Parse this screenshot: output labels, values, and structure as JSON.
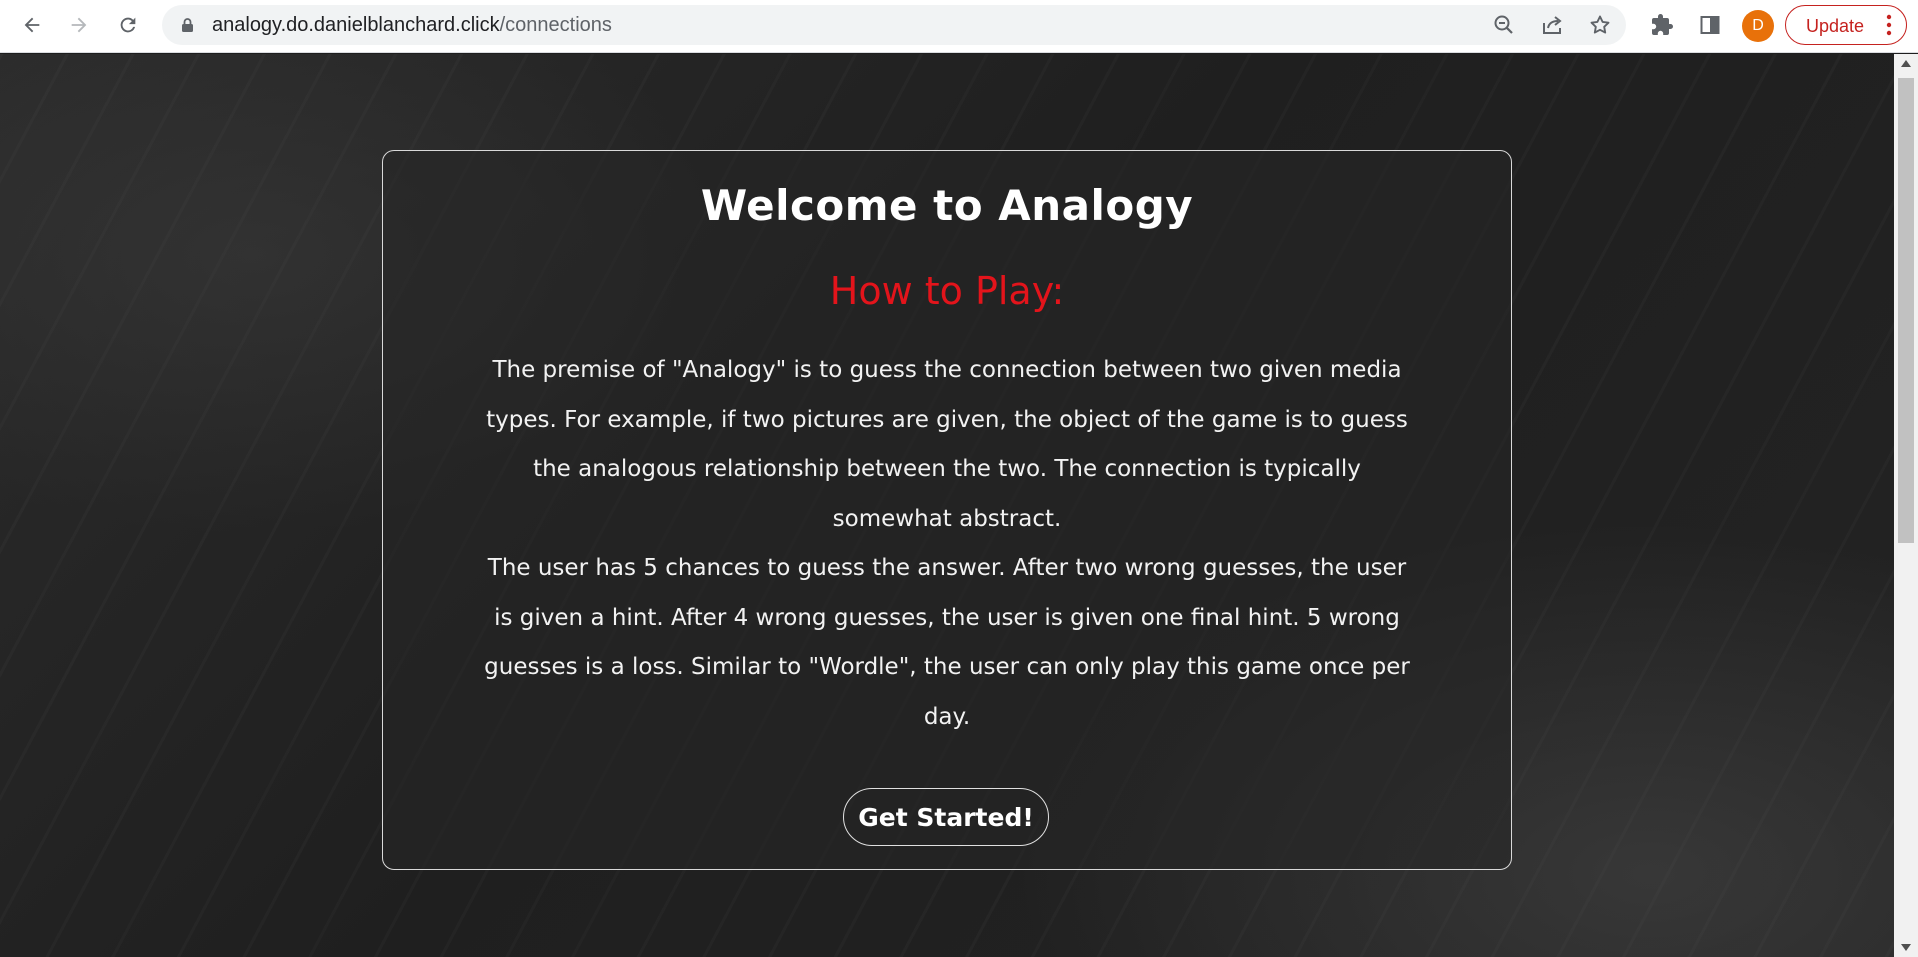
{
  "browser": {
    "url_host": "analogy.do.danielblanchard.click",
    "url_path": "/connections",
    "profile_initial": "D",
    "update_label": "Update",
    "icons": [
      "back-arrow-icon",
      "forward-arrow-icon",
      "reload-icon",
      "lock-icon",
      "zoom-out-icon",
      "share-icon",
      "star-bookmark-icon",
      "extensions-puzzle-icon",
      "side-panel-icon",
      "kebab-menu-icon"
    ],
    "colors": {
      "update_accent": "#c5221f",
      "avatar": "#e8710a"
    }
  },
  "page": {
    "title": "Welcome to Analogy",
    "subtitle": "How to Play:",
    "paragraph_1": "The premise of \"Analogy\" is to guess the connection between two given media types. For example, if two pictures are given, the object of the game is to guess the analogous relationship between the two. The connection is typically somewhat abstract.",
    "paragraph_2": "The user has 5 chances to guess the answer. After two wrong guesses, the user is given a hint. After 4 wrong guesses, the user is given one final hint. 5 wrong guesses is a loss. Similar to \"Wordle\", the user can only play this game once per day.",
    "cta_label": "Get Started!",
    "colors": {
      "subtitle": "#e3141b",
      "text": "#ffffff"
    }
  }
}
